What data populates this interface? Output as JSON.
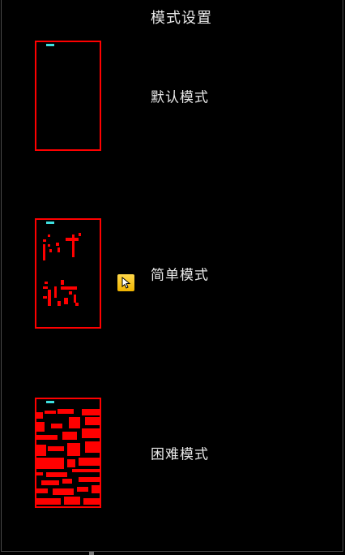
{
  "title": "模式设置",
  "modes": [
    {
      "label": "默认模式",
      "selected": false
    },
    {
      "label": "简单模式",
      "selected": true
    },
    {
      "label": "困难模式",
      "selected": false
    }
  ],
  "colors": {
    "background": "#000000",
    "preview_border": "#ff0000",
    "brick": "#ff0000",
    "paddle": "#3ee0e0",
    "selector": "#f5c518",
    "text": "#e8e8e8"
  },
  "icons": {
    "selector": "cursor-pointer-icon"
  }
}
